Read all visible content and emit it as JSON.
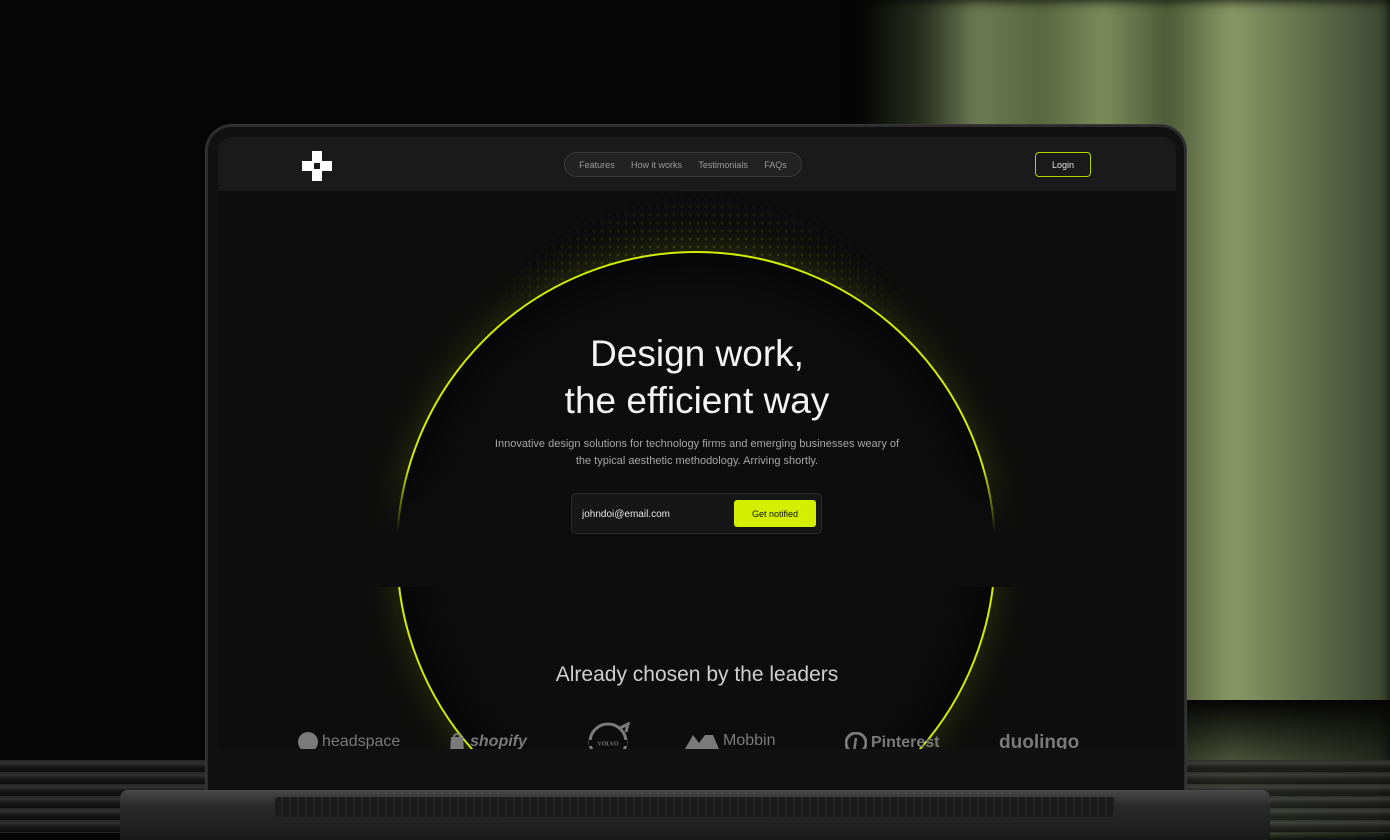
{
  "nav": {
    "links": [
      "Features",
      "How it works",
      "Testimonials",
      "FAQs"
    ],
    "login_label": "Login"
  },
  "hero": {
    "title_line1": "Design work,",
    "title_line2": "the efficient way",
    "subtitle": "Innovative design solutions for technology firms and emerging businesses weary of the typical aesthetic methodology. Arriving shortly.",
    "email_value": "johndoi@email.com",
    "cta_label": "Get notified"
  },
  "leaders": {
    "heading": "Already chosen by the leaders",
    "brands": [
      "headspace",
      "shopify",
      "VOLVO",
      "Mobbin",
      "Pinterest",
      "duolingo"
    ]
  },
  "colors": {
    "accent": "#d4f000",
    "background": "#0d0d0d",
    "navbar": "#1a1a1a"
  }
}
